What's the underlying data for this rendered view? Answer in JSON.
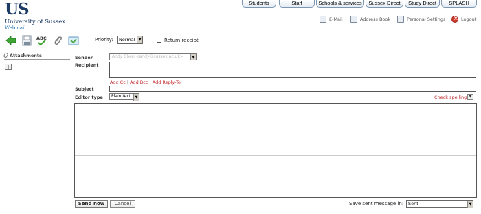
{
  "logo": {
    "mark": "US",
    "university": "University of Sussex",
    "app": "Webmail"
  },
  "tabs": [
    "Students",
    "Staff",
    "Schools & services",
    "Sussex Direct",
    "Study Direct",
    "SPLASH"
  ],
  "header_links": {
    "email": "E-Mail",
    "address_book": "Address Book",
    "personal_settings": "Personal Settings",
    "logout": "Logout"
  },
  "toolbar": {
    "icons": [
      "back-arrow-icon",
      "save-draft-icon",
      "spell-check-icon",
      "attach-icon",
      "insert-image-icon"
    ],
    "spell_text": "ABC",
    "priority_label": "Priority:",
    "priority_value": "Normal",
    "return_receipt_label": "Return receipt",
    "return_receipt_checked": false
  },
  "attachments": {
    "title": "Attachments",
    "add_label": "+"
  },
  "compose": {
    "sender_label": "Sender",
    "sender_value": "Andy Chen <andy@sussex.ac.uk>",
    "recipient_label": "Recipient",
    "recipient_value": "",
    "add_cc": "Add Cc",
    "add_bcc": "Add Bcc",
    "add_replyto": "Add Reply-To",
    "separator": "|",
    "subject_label": "Subject",
    "subject_value": "",
    "editor_type_label": "Editor type",
    "editor_type_value": "Plain text",
    "check_spelling": "Check spelling",
    "body": ""
  },
  "footer": {
    "send_now": "Send now",
    "cancel": "Cancel",
    "save_sent_label": "Save sent message in:",
    "save_sent_value": "Sent"
  },
  "colors": {
    "brand": "#1b3a64",
    "link_red": "#c0282b",
    "tab_border": "#7d97b3"
  }
}
